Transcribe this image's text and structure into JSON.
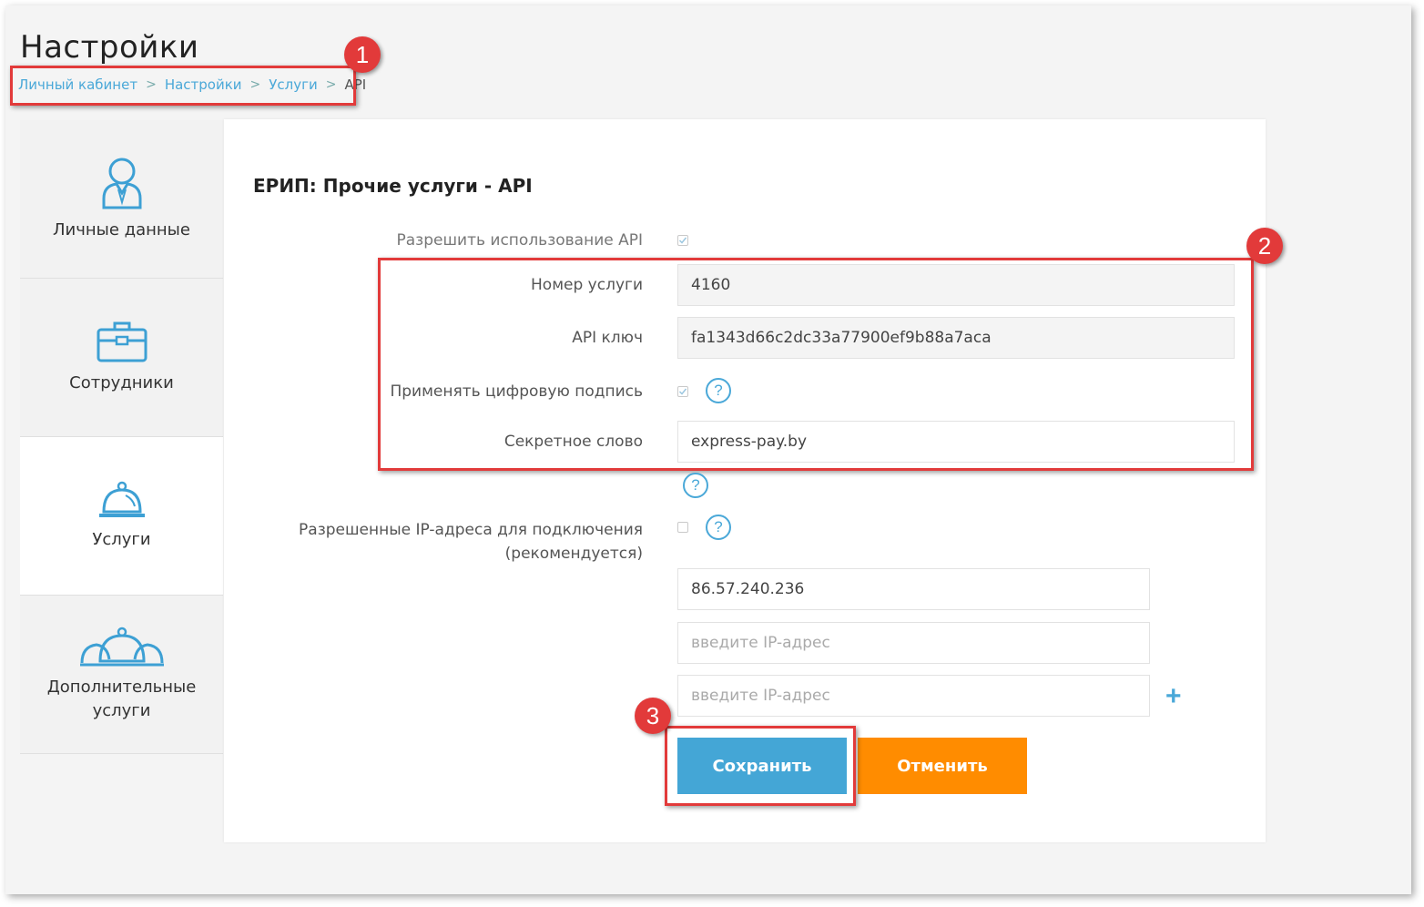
{
  "header": {
    "title": "Настройки",
    "breadcrumb": [
      "Личный кабинет",
      "Настройки",
      "Услуги",
      "API"
    ]
  },
  "annotations": [
    "1",
    "2",
    "3"
  ],
  "sidebar": {
    "items": [
      {
        "label": "Личные данные",
        "icon": "user-icon"
      },
      {
        "label": "Сотрудники",
        "icon": "briefcase-icon"
      },
      {
        "label": "Услуги",
        "icon": "cloche-icon",
        "active": true
      },
      {
        "label": "Дополнительные услуги",
        "icon": "cloches-icon"
      }
    ]
  },
  "form": {
    "section_title": "ЕРИП: Прочие услуги - API",
    "allow_api_label": "Разрешить использование API",
    "allow_api_checked": true,
    "service_number_label": "Номер услуги",
    "service_number_value": "4160",
    "api_key_label": "API ключ",
    "api_key_value": "fa1343d66c2dc33a77900ef9b88a7aca",
    "digital_signature_label": "Применять цифровую подпись",
    "digital_signature_checked": true,
    "secret_word_label": "Секретное слово",
    "secret_word_value": "express-pay.by",
    "allowed_ips_label_line1": "Разрешенные IP-адреса для подключения",
    "allowed_ips_label_line2": "(рекомендуется)",
    "allowed_ips_checked": false,
    "ip_1_value": "86.57.240.236",
    "ip_placeholder": "введите IP-адрес",
    "help_glyph": "?",
    "add_glyph": "+"
  },
  "buttons": {
    "save_label": "Сохранить",
    "cancel_label": "Отменить"
  },
  "colors": {
    "accent_blue": "#44a6d6",
    "cancel_orange": "#ff8c00",
    "annotation_red": "#e23a3a"
  }
}
